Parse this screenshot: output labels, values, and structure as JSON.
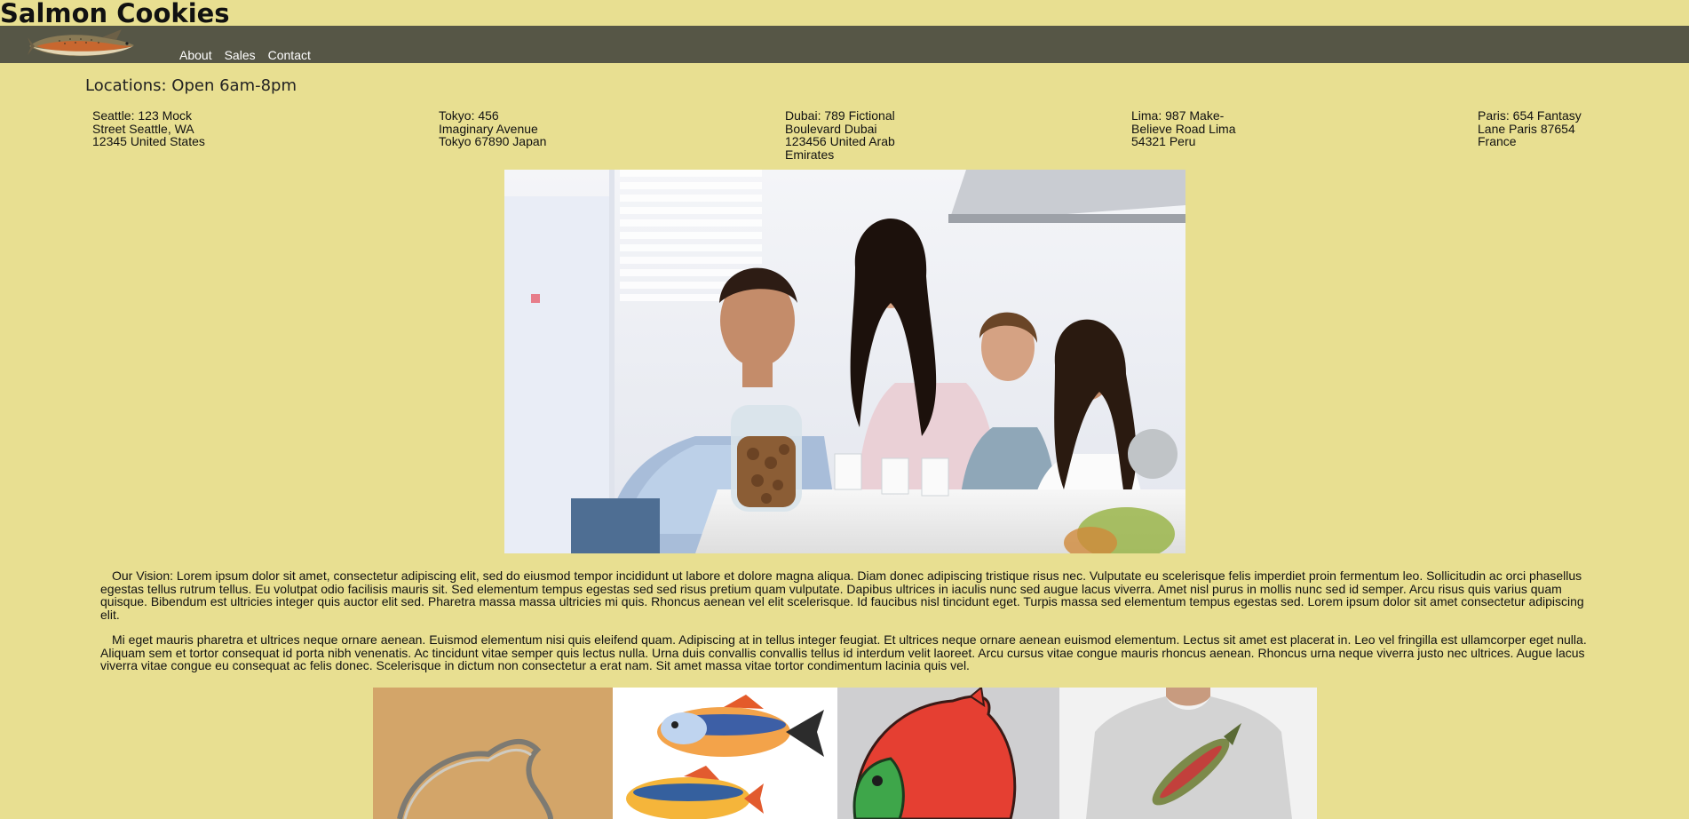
{
  "site": {
    "title": "Salmon Cookies"
  },
  "nav": {
    "logo_icon": "salmon-fish-logo",
    "links": [
      "About",
      "Sales",
      "Contact"
    ]
  },
  "locations": {
    "heading": "Locations: Open 6am-8pm",
    "items": [
      {
        "lines": [
          "Seattle: 123 Mock",
          "Street Seattle, WA",
          "12345 United States"
        ]
      },
      {
        "lines": [
          "Tokyo: 456",
          "Imaginary Avenue",
          "Tokyo 67890 Japan"
        ]
      },
      {
        "lines": [
          "Dubai: 789 Fictional",
          "Boulevard Dubai",
          "123456 United Arab",
          "Emirates"
        ]
      },
      {
        "lines": [
          "Lima: 987 Make-",
          "Believe Road Lima",
          "54321 Peru"
        ]
      },
      {
        "lines": [
          "Paris: 654 Fantasy",
          "Lane Paris 87654",
          "France"
        ]
      }
    ]
  },
  "hero": {
    "image_alt": "family-in-kitchen-with-cookies-photo"
  },
  "vision": {
    "paragraphs": [
      "Our Vision: Lorem ipsum dolor sit amet, consectetur adipiscing elit, sed do eiusmod tempor incididunt ut labore et dolore magna aliqua. Diam donec adipiscing tristique risus nec. Vulputate eu scelerisque felis imperdiet proin fermentum leo. Sollicitudin ac orci phasellus egestas tellus rutrum tellus. Eu volutpat odio facilisis mauris sit. Sed elementum tempus egestas sed sed risus pretium quam vulputate. Dapibus ultrices in iaculis nunc sed augue lacus viverra. Amet nisl purus in mollis nunc sed id semper. Arcu risus quis varius quam quisque. Bibendum est ultricies integer quis auctor elit sed. Pharetra massa massa ultricies mi quis. Rhoncus aenean vel elit scelerisque. Id faucibus nisl tincidunt eget. Turpis massa sed elementum tempus egestas sed. Lorem ipsum dolor sit amet consectetur adipiscing elit.",
      "Mi eget mauris pharetra et ultrices neque ornare aenean. Euismod elementum nisi quis eleifend quam. Adipiscing at in tellus integer feugiat. Et ultrices neque ornare aenean euismod elementum. Lectus sit amet est placerat in. Leo vel fringilla est ullamcorper eget nulla. Aliquam sem et tortor consequat id porta nibh venenatis. Ac tincidunt vitae semper quis lectus nulla. Urna duis convallis convallis tellus id interdum velit laoreet. Arcu cursus vitae congue mauris rhoncus aenean. Rhoncus urna neque viverra justo nec ultrices. Augue lacus viverra vitae congue eu consequat ac felis donec. Scelerisque in dictum non consectetur a erat nam. Sit amet massa vitae tortor condimentum lacinia quis vel."
    ]
  },
  "gallery": {
    "items": [
      {
        "name": "fish-cookie-cutter-photo"
      },
      {
        "name": "fish-magnets-photo"
      },
      {
        "name": "salmon-cookie-photo"
      },
      {
        "name": "salmon-tshirt-photo"
      }
    ]
  },
  "colors": {
    "page_background": "#e8df91",
    "nav_background": "#565646",
    "nav_text": "#ffffff"
  }
}
